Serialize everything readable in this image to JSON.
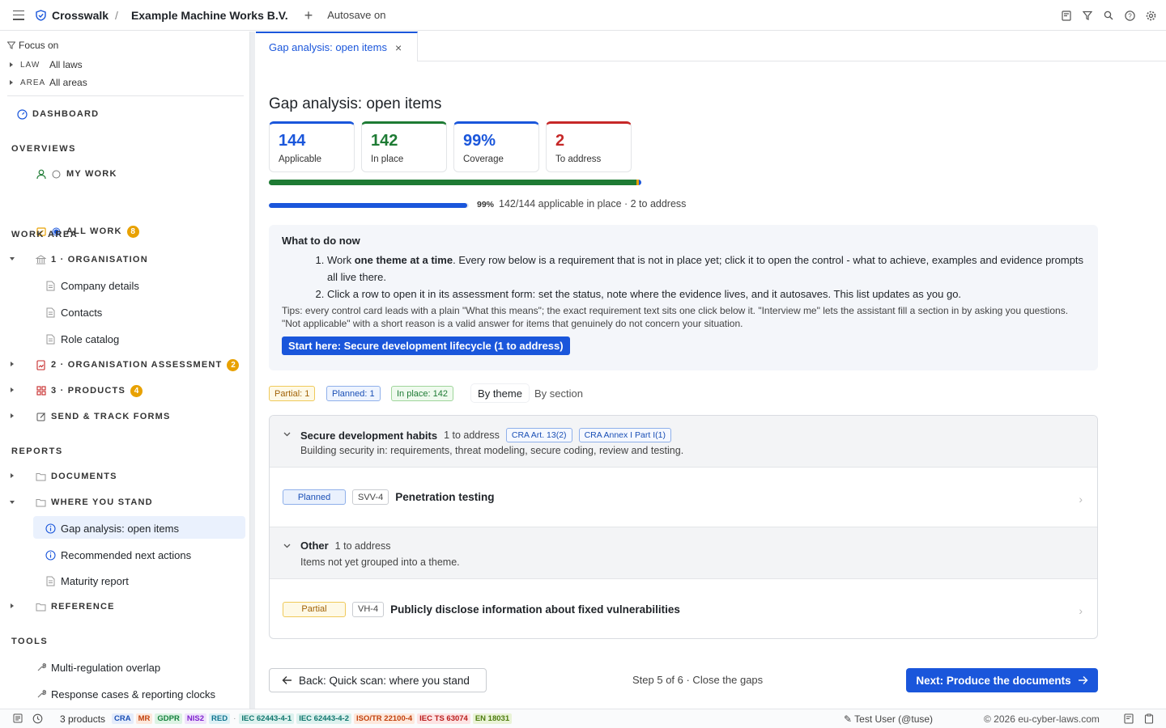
{
  "topbar": {
    "brand": "Crosswalk",
    "separator": "/",
    "organisation": "Example Machine Works B.V.",
    "plus": "+",
    "autosave": "Autosave on"
  },
  "sidebar": {
    "focus_label": "Focus on",
    "filters": [
      {
        "key": "LAW",
        "value": "All laws"
      },
      {
        "key": "AREA",
        "value": "All areas"
      }
    ],
    "dashboard": "DASHBOARD",
    "overviews_head": "OVERVIEWS",
    "my_work": "MY WORK",
    "all_work": "ALL WORK",
    "all_work_count": "8",
    "work_area_head": "WORK AREA",
    "organisation": "1 · ORGANISATION",
    "company_details": "Company details",
    "contacts": "Contacts",
    "role_catalog": "Role catalog",
    "org_assessment": "2 · ORGANISATION ASSESSMENT",
    "org_assessment_count": "2",
    "products": "3 · PRODUCTS",
    "products_count": "4",
    "send_track": "SEND & TRACK FORMS",
    "reports_head": "REPORTS",
    "documents": "DOCUMENTS",
    "where_you_stand": "WHERE YOU STAND",
    "gap_analysis": "Gap analysis: open items",
    "recommended": "Recommended next actions",
    "maturity": "Maturity report",
    "reference": "REFERENCE",
    "tools_head": "TOOLS",
    "multi_reg": "Multi-regulation overlap",
    "response_cases": "Response cases & reporting clocks"
  },
  "tab": {
    "label": "Gap analysis: open items",
    "close": "×"
  },
  "page": {
    "title": "Gap analysis: open items",
    "kpis": [
      {
        "value": "144",
        "label": "Applicable",
        "color": "#1a56db"
      },
      {
        "value": "142",
        "label": "In place",
        "color": "#1e7b34"
      },
      {
        "value": "99%",
        "label": "Coverage",
        "color": "#1a56db"
      },
      {
        "value": "2",
        "label": "To address",
        "color": "#c62828"
      }
    ],
    "coverage_fraction": 0.99,
    "status_split": {
      "in_place": 142,
      "partial": 1,
      "planned": 1,
      "total": 144
    },
    "progress_pct": "99%",
    "progress_text": "142/144 applicable in place · 2 to address"
  },
  "todo": {
    "title": "What to do now",
    "step1_a": "Work ",
    "step1_bold": "one theme at a time",
    "step1_b": ". Every row below is a requirement that is not in place yet; click it to open the control - what to achieve, examples and evidence prompts all live there.",
    "step2": "Click a row to open it in its assessment form: set the status, note where the evidence lives, and it autosaves. This list updates as you go.",
    "tips": "Tips: every control card leads with a plain \"What this means\"; the exact requirement text sits one click below it. \"Interview me\" lets the assistant fill a section in by asking you questions. \"Not applicable\" with a short reason is a valid answer for items that genuinely do not concern your situation.",
    "start_button": "Start here: Secure development lifecycle (1 to address)"
  },
  "filters": {
    "partial": "Partial: 1",
    "planned": "Planned: 1",
    "in_place": "In place: 142",
    "by_theme": "By theme",
    "by_section": "By section"
  },
  "groups": [
    {
      "title": "Secure development habits",
      "count": "1 to address",
      "tags": [
        "CRA Art. 13(2)",
        "CRA Annex I Part I(1)"
      ],
      "desc": "Building security in: requirements, threat modeling, secure coding, review and testing.",
      "item": {
        "status": "Planned",
        "code": "SVV-4",
        "title": "Penetration testing"
      }
    },
    {
      "title": "Other",
      "count": "1 to address",
      "tags": [],
      "desc": "Items not yet grouped into a theme.",
      "item": {
        "status": "Partial",
        "code": "VH-4",
        "title": "Publicly disclose information about fixed vulnerabilities"
      }
    }
  ],
  "footer_nav": {
    "back": "Back: Quick scan: where you stand",
    "step": "Step 5 of 6 · Close the gaps",
    "next": "Next: Produce the documents"
  },
  "statusbar": {
    "products": "3 products",
    "tags": [
      {
        "label": "CRA",
        "fg": "#1a4fb5",
        "bg": "#e4ecfb"
      },
      {
        "label": "MR",
        "fg": "#c2410c",
        "bg": "#fde8dc"
      },
      {
        "label": "GDPR",
        "fg": "#15803d",
        "bg": "#dcf3e3"
      },
      {
        "label": "NIS2",
        "fg": "#7e22ce",
        "bg": "#efe3fb"
      },
      {
        "label": "RED",
        "fg": "#0e7490",
        "bg": "#dcf1f5"
      }
    ],
    "standards": [
      {
        "label": "IEC 62443-4-1",
        "fg": "#0f766e",
        "bg": "#dcf1ee"
      },
      {
        "label": "IEC 62443-4-2",
        "fg": "#0f766e",
        "bg": "#dcf1ee"
      },
      {
        "label": "ISO/TR 22100-4",
        "fg": "#c2410c",
        "bg": "#fde8dc"
      },
      {
        "label": "IEC TS 63074",
        "fg": "#b91c1c",
        "bg": "#fde3e3"
      },
      {
        "label": "EN 18031",
        "fg": "#4d7c0f",
        "bg": "#e9f3d6"
      }
    ],
    "user": "✎ Test User (@tuse)",
    "copyright": "© 2026 eu-cyber-laws.com"
  }
}
